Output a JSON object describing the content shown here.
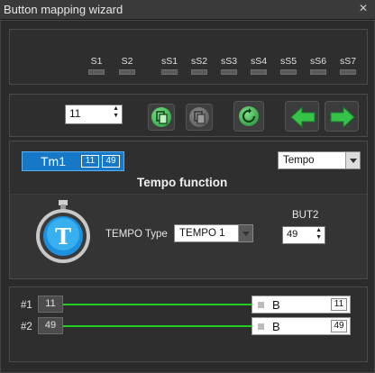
{
  "window": {
    "title": "Button mapping wizard",
    "close_glyph": "✕"
  },
  "slots": [
    "S1",
    "S2",
    "sS1",
    "sS2",
    "sS3",
    "sS4",
    "sS5",
    "sS6",
    "sS7"
  ],
  "toolbar": {
    "number_value": "11"
  },
  "tm_button": {
    "label": "Tm1",
    "badge1": "11",
    "badge2": "49"
  },
  "function_dropdown": {
    "value": "Tempo"
  },
  "section_title": "Tempo function",
  "tempo": {
    "type_label": "TEMPO Type",
    "type_value": "TEMPO 1",
    "but_label": "BUT2",
    "but_value": "49",
    "icon_letter": "T"
  },
  "mappings": [
    {
      "label": "#1",
      "number": "11",
      "target": "B",
      "target_number": "11"
    },
    {
      "label": "#2",
      "number": "49",
      "target": "B",
      "target_number": "49"
    }
  ],
  "colors": {
    "accent": "#1778c8",
    "wire": "#22cc22",
    "green_button": "#2eb84a"
  },
  "icons": [
    "copy-icon",
    "paste-icon",
    "refresh-icon",
    "arrow-left-icon",
    "arrow-right-icon",
    "stopwatch-icon"
  ]
}
